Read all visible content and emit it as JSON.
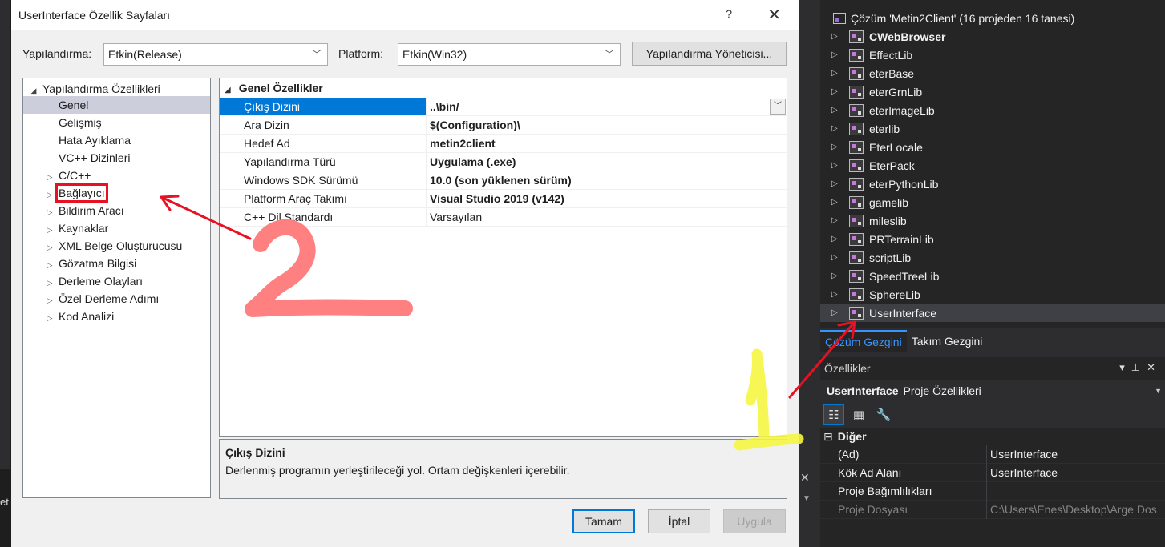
{
  "dialog": {
    "title": "UserInterface Özellik Sayfaları",
    "help": "?",
    "close": "✕",
    "config_label": "Yapılandırma:",
    "config_value": "Etkin(Release)",
    "platform_label": "Platform:",
    "platform_value": "Etkin(Win32)",
    "config_manager_button": "Yapılandırma Yöneticisi...",
    "tree": [
      {
        "label": "Yapılandırma Özellikleri",
        "arrow": "◢",
        "indent": 0
      },
      {
        "label": "Genel",
        "arrow": "",
        "indent": 1,
        "selected": true
      },
      {
        "label": "Gelişmiş",
        "arrow": "",
        "indent": 1
      },
      {
        "label": "Hata Ayıklama",
        "arrow": "",
        "indent": 1
      },
      {
        "label": "VC++ Dizinleri",
        "arrow": "",
        "indent": 1
      },
      {
        "label": "C/C++",
        "arrow": "▷",
        "indent": 1
      },
      {
        "label": "Bağlayıcı",
        "arrow": "▷",
        "indent": 1,
        "highlight": true
      },
      {
        "label": "Bildirim Aracı",
        "arrow": "▷",
        "indent": 1
      },
      {
        "label": "Kaynaklar",
        "arrow": "▷",
        "indent": 1
      },
      {
        "label": "XML Belge Oluşturucusu",
        "arrow": "▷",
        "indent": 1
      },
      {
        "label": "Gözatma Bilgisi",
        "arrow": "▷",
        "indent": 1
      },
      {
        "label": "Derleme Olayları",
        "arrow": "▷",
        "indent": 1
      },
      {
        "label": "Özel Derleme Adımı",
        "arrow": "▷",
        "indent": 1
      },
      {
        "label": "Kod Analizi",
        "arrow": "▷",
        "indent": 1
      }
    ],
    "grid": {
      "category": "Genel Özellikler",
      "rows": [
        {
          "name": "Çıkış Dizini",
          "value": "..\\bin/",
          "bold": true,
          "selected": true
        },
        {
          "name": "Ara Dizin",
          "value": "$(Configuration)\\",
          "bold": true
        },
        {
          "name": "Hedef Ad",
          "value": "metin2client",
          "bold": true
        },
        {
          "name": "Yapılandırma Türü",
          "value": "Uygulama (.exe)",
          "bold": true
        },
        {
          "name": "Windows SDK Sürümü",
          "value": "10.0 (son yüklenen sürüm)",
          "bold": true
        },
        {
          "name": "Platform Araç Takımı",
          "value": "Visual Studio 2019 (v142)",
          "bold": true
        },
        {
          "name": "C++ Dil Standardı",
          "value": "Varsayılan",
          "bold": false
        }
      ]
    },
    "description": {
      "title": "Çıkış Dizini",
      "text": "Derlenmiş programın yerleştirileceği yol. Ortam değişkenleri içerebilir."
    },
    "buttons": {
      "ok": "Tamam",
      "cancel": "İptal",
      "apply": "Uygula"
    }
  },
  "solution_explorer": {
    "root": "Çözüm 'Metin2Client' (16 projeden 16 tanesi)",
    "projects": [
      {
        "name": "CWebBrowser",
        "bold": true
      },
      {
        "name": "EffectLib"
      },
      {
        "name": "eterBase"
      },
      {
        "name": "eterGrnLib"
      },
      {
        "name": "eterImageLib"
      },
      {
        "name": "eterlib"
      },
      {
        "name": "EterLocale"
      },
      {
        "name": "EterPack"
      },
      {
        "name": "eterPythonLib"
      },
      {
        "name": "gamelib"
      },
      {
        "name": "mileslib"
      },
      {
        "name": "PRTerrainLib"
      },
      {
        "name": "scriptLib"
      },
      {
        "name": "SpeedTreeLib"
      },
      {
        "name": "SphereLib"
      },
      {
        "name": "UserInterface",
        "selected": true
      }
    ],
    "tabs": [
      "Çözüm Gezgini",
      "Takım Gezgini"
    ]
  },
  "properties_panel": {
    "title": "Özellikler",
    "object_name": "UserInterface",
    "object_type": "Proje Özellikleri",
    "category": "Diğer",
    "rows": [
      {
        "name": "(Ad)",
        "value": "UserInterface"
      },
      {
        "name": "Kök Ad Alanı",
        "value": "UserInterface"
      },
      {
        "name": "Proje Bağımlılıkları",
        "value": ""
      },
      {
        "name": "Proje Dosyası",
        "value": "C:\\Users\\Enes\\Desktop\\Arge Dos",
        "dim": true
      }
    ]
  },
  "colors": {
    "accent": "#0078d7",
    "annotation_red": "#e81123",
    "annotation_pink": "#ff8080",
    "annotation_yellow": "#f5f542"
  }
}
